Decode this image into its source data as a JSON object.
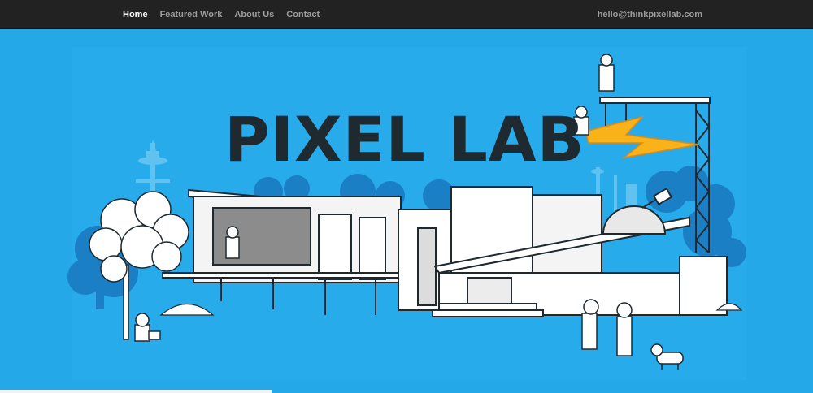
{
  "nav": {
    "links": [
      {
        "label": "Home",
        "active": true
      },
      {
        "label": "Featured Work",
        "active": false
      },
      {
        "label": "About Us",
        "active": false
      },
      {
        "label": "Contact",
        "active": false
      }
    ],
    "email": "hello@thinkpixellab.com"
  },
  "hero": {
    "logo_text": "PIXEL LAB",
    "colors": {
      "sky": "#24a8e8",
      "navbar": "#222222",
      "logo": "#1f2a30",
      "lightning": "#f9b21a",
      "tree_dark": "#1a7fc4"
    },
    "illustration_icons": [
      "space-needle-icon",
      "lab-building-icon",
      "tree-icon",
      "tower-icon",
      "lightning-bolt-icon",
      "observatory-dome-icon",
      "scientist-figure-icon",
      "dog-icon"
    ]
  }
}
